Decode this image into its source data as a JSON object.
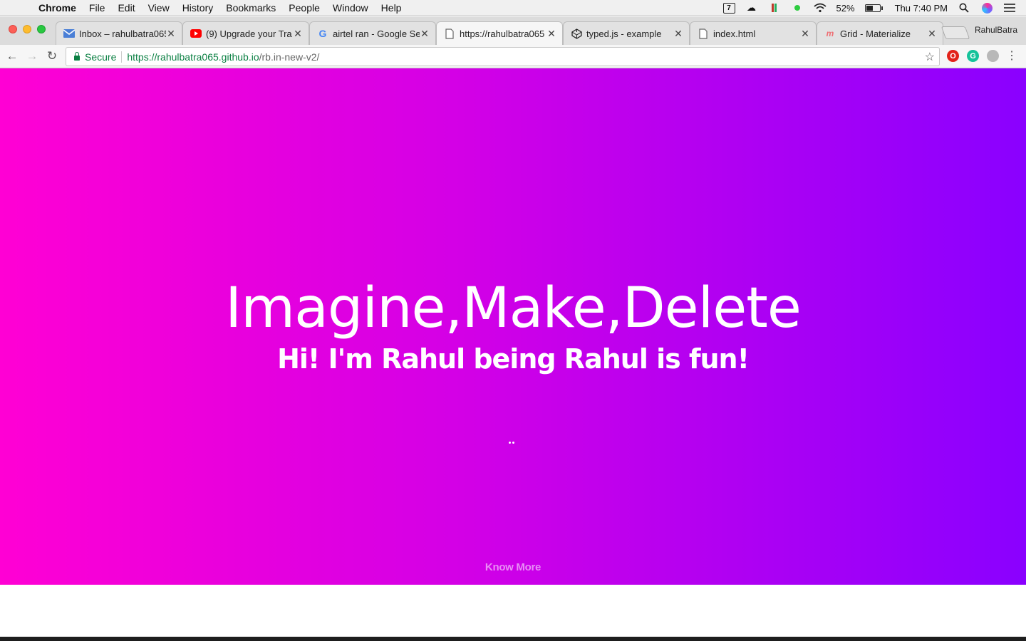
{
  "menubar": {
    "app_name": "Chrome",
    "items": [
      "File",
      "Edit",
      "View",
      "History",
      "Bookmarks",
      "People",
      "Window",
      "Help"
    ],
    "calendar_day": "7",
    "battery_percent": "52%",
    "battery_level": 0.52,
    "clock": "Thu 7:40 PM"
  },
  "tabs": [
    {
      "title": "Inbox – rahulbatra065",
      "icon": "gmail-icon",
      "active": false
    },
    {
      "title": "(9) Upgrade your Tra",
      "icon": "youtube-icon",
      "active": false
    },
    {
      "title": "airtel ran - Google Se",
      "icon": "google-icon",
      "active": false
    },
    {
      "title": "https://rahulbatra065",
      "icon": "page-icon",
      "active": true
    },
    {
      "title": "typed.js - example",
      "icon": "codepen-icon",
      "active": false
    },
    {
      "title": "index.html",
      "icon": "file-icon",
      "active": false
    },
    {
      "title": "Grid - Materialize",
      "icon": "materialize-icon",
      "active": false
    }
  ],
  "profile_name": "RahulBatra",
  "omnibox": {
    "secure_label": "Secure",
    "url_host": "https://rahulbatra065.github.io",
    "url_path": "/rb.in-new-v2/"
  },
  "hero": {
    "headline": "Imagine,Make,Delete",
    "subline": "Hi! I'm Rahul being Rahul is fun!",
    "cta": "Know More"
  },
  "colors": {
    "gradient_start": "#ff00d4",
    "gradient_end": "#8a00ff",
    "secure_green": "#0b8043"
  }
}
